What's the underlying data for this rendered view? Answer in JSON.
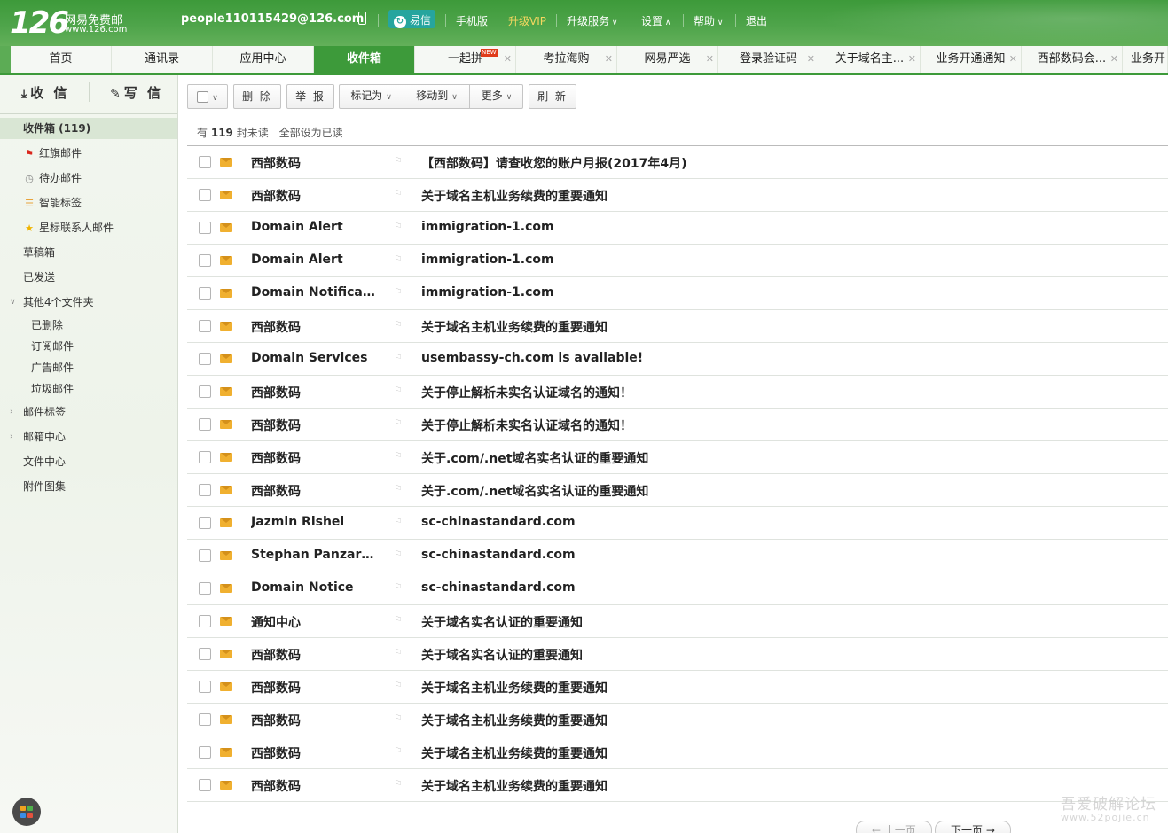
{
  "header": {
    "logo_number": "126",
    "logo_text": "网易免费邮",
    "logo_url": "www.126.com",
    "user_email": "people110115429@126.com",
    "yixin_label": "易信",
    "links": {
      "mobile": "手机版",
      "vip": "升级VIP",
      "upgrade": "升级服务",
      "settings": "设置",
      "help": "帮助",
      "logout": "退出"
    }
  },
  "tabs": [
    {
      "label": "首页"
    },
    {
      "label": "通讯录"
    },
    {
      "label": "应用中心"
    },
    {
      "label": "收件箱"
    },
    {
      "label": "一起拼",
      "badge": "NEW"
    },
    {
      "label": "考拉海购"
    },
    {
      "label": "网易严选"
    },
    {
      "label": "登录验证码"
    },
    {
      "label": "关于域名主..."
    },
    {
      "label": "业务开通通知"
    },
    {
      "label": "西部数码会..."
    },
    {
      "label": "业务开"
    }
  ],
  "sidebar": {
    "receive_label": "收 信",
    "write_label": "写 信",
    "items": [
      {
        "label": "收件箱 (119)"
      },
      {
        "label": "红旗邮件"
      },
      {
        "label": "待办邮件"
      },
      {
        "label": "智能标签"
      },
      {
        "label": "星标联系人邮件"
      },
      {
        "label": "草稿箱"
      },
      {
        "label": "已发送"
      },
      {
        "label": "其他4个文件夹"
      },
      {
        "label": "已删除"
      },
      {
        "label": "订阅邮件"
      },
      {
        "label": "广告邮件"
      },
      {
        "label": "垃圾邮件"
      },
      {
        "label": "邮件标签"
      },
      {
        "label": "邮箱中心"
      },
      {
        "label": "文件中心"
      },
      {
        "label": "附件图集"
      }
    ]
  },
  "toolbar": {
    "delete": "删 除",
    "report": "举 报",
    "mark_as": "标记为",
    "move_to": "移动到",
    "more": "更多",
    "refresh": "刷 新"
  },
  "unread": {
    "prefix": "有",
    "count": "119",
    "suffix": "封未读",
    "mark_all": "全部设为已读"
  },
  "mails": [
    {
      "sender": "西部数码",
      "subject": "【西部数码】请查收您的账户月报(2017年4月)"
    },
    {
      "sender": "西部数码",
      "subject": "关于域名主机业务续费的重要通知"
    },
    {
      "sender": "Domain Alert",
      "subject": "immigration-1.com"
    },
    {
      "sender": "Domain Alert",
      "subject": "immigration-1.com"
    },
    {
      "sender": "Domain Notificat...",
      "subject": "immigration-1.com"
    },
    {
      "sender": "西部数码",
      "subject": "关于域名主机业务续费的重要通知"
    },
    {
      "sender": "Domain Services",
      "subject": "usembassy-ch.com is available!"
    },
    {
      "sender": "西部数码",
      "subject": "关于停止解析未实名认证域名的通知！"
    },
    {
      "sender": "西部数码",
      "subject": "关于停止解析未实名认证域名的通知！"
    },
    {
      "sender": "西部数码",
      "subject": "关于.com/.net域名实名认证的重要通知"
    },
    {
      "sender": "西部数码",
      "subject": "关于.com/.net域名实名认证的重要通知"
    },
    {
      "sender": "Jazmin Rishel",
      "subject": "sc-chinastandard.com"
    },
    {
      "sender": "Stephan Panzarino",
      "subject": "sc-chinastandard.com"
    },
    {
      "sender": "Domain Notice",
      "subject": "sc-chinastandard.com"
    },
    {
      "sender": "通知中心",
      "subject": "关于域名实名认证的重要通知"
    },
    {
      "sender": "西部数码",
      "subject": "关于域名实名认证的重要通知"
    },
    {
      "sender": "西部数码",
      "subject": "关于域名主机业务续费的重要通知"
    },
    {
      "sender": "西部数码",
      "subject": "关于域名主机业务续费的重要通知"
    },
    {
      "sender": "西部数码",
      "subject": "关于域名主机业务续费的重要通知"
    },
    {
      "sender": "西部数码",
      "subject": "关于域名主机业务续费的重要通知"
    }
  ],
  "pager": {
    "prev": "上一页",
    "next": "下一页"
  },
  "watermark": {
    "line1": "吾爱破解论坛",
    "line2": "www.52pojie.cn"
  },
  "colors": {
    "brand_green": "#3d9a3a",
    "envelope": "#f0b030",
    "flag_red": "#d9261c",
    "vip_gold": "#f5d760"
  }
}
